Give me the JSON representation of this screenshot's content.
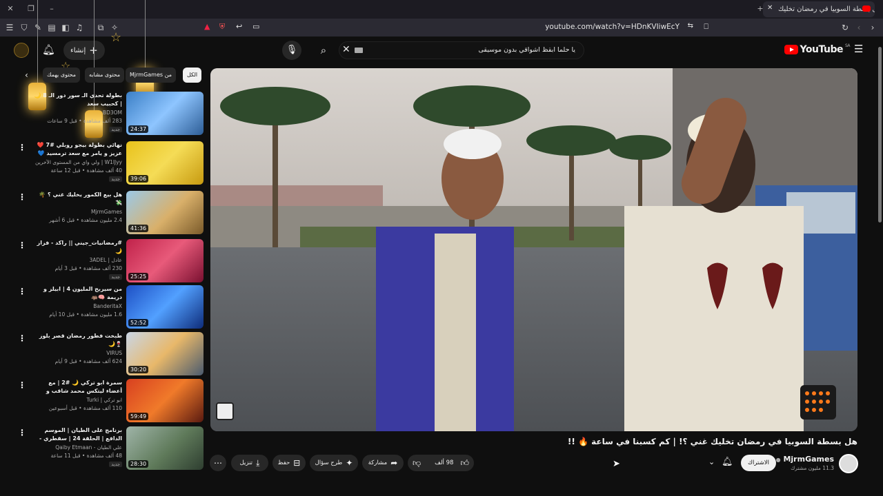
{
  "browser": {
    "tab_title": "هل بسطة السوبيا في رمضان تخليك",
    "url": "youtube.com/watch?v=HDnKVIiwEcY"
  },
  "header": {
    "logo_text": "YouTube",
    "logo_region": "SA",
    "search_query": "يا حلما ابقظ اشواقي بدون موسيقى",
    "create_label": "إنشاء"
  },
  "chips": [
    {
      "label": "الكل"
    },
    {
      "label": "من MjrmGames"
    },
    {
      "label": "محتوى مشابه"
    },
    {
      "label": "محتوى يهمك"
    }
  ],
  "recommendations": [
    {
      "title": "بطولة تحدي الـ سور دور الـ 8 🌙 | كحبيب سعد",
      "channel": "BD3OM",
      "meta": "283 ألف مشاهدة • قبل 9 ساعات",
      "duration": "24:37",
      "new": "جديد"
    },
    {
      "title": "نهائي بطولة بيجو روبلي #7 ❤️ عزيز و يامر مع سعد ترمسيد 💙 🔥",
      "channel": "W1lJyy | ولي واي من المستوى الآخرين",
      "meta": "40 ألف مشاهدة • قبل 12 ساعة",
      "duration": "39:06",
      "new": "جديد"
    },
    {
      "title": "هل بيع الكمور يخليك غني ؟ 🌴💸",
      "channel": "MjrmGames",
      "meta": "2.4 مليون مشاهدة • قبل 6 أشهر",
      "duration": "41:36",
      "new": ""
    },
    {
      "title": "#رمضانيات_جيني || راكد - فزاز 🌙",
      "channel": "عادل | 3ADEL",
      "meta": "230 ألف مشاهدة • قبل 3 أيام",
      "duration": "25:25",
      "new": "جديد"
    },
    {
      "title": "من سيربح المليون 4 | ابيلز و دريمة 🧠🦛",
      "channel": "BanderitaX",
      "meta": "1.6 مليون مشاهدة • قبل 10 أيام",
      "duration": "52:52",
      "new": ""
    },
    {
      "title": "طبخت فطور رمضان قصر بلوز 🍷🌙",
      "channel": "VIRUS",
      "meta": "624 ألف مشاهدة • قبل 9 أيام",
      "duration": "30:20",
      "new": ""
    },
    {
      "title": "سمرة ابو تركي 🌙 #2 | مع أعضاء ليتكس محمد شاقب و حاري 😜🔥 !!",
      "channel": "ابو تركي | Turki",
      "meta": "110 ألف مشاهدة • قبل أسبوعين",
      "duration": "59:49",
      "new": ""
    },
    {
      "title": "برنامج على الطيان | الموسم الدافع | الحلقة 24 | سقطري - السياحة",
      "channel": "علي الطيان - Qaiby Etmaan",
      "meta": "48 ألف مشاهدة • قبل 11 ساعة",
      "duration": "28:30",
      "new": "جديد"
    }
  ],
  "video": {
    "title": "هل بسطة السوبيا في رمضان تخليك غني ؟! | كم كسبنا في ساعة 🔥 !!",
    "channel": "MjrmGames",
    "subscribers": "11.3 مليون مشترك",
    "subscribe_label": "الاشتراك",
    "likes": "98 ألف",
    "share_label": "مشاركة",
    "ask_label": "طرح سؤال",
    "save_label": "حفظ",
    "download_label": "تنزيل"
  },
  "colors": {
    "accent": "#ff0000",
    "background": "#0f0f0f",
    "chip": "#272727"
  }
}
